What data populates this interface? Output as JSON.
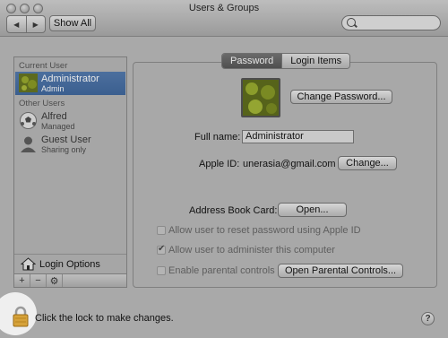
{
  "window": {
    "title": "Users & Groups"
  },
  "toolbar": {
    "back_icon": "back-arrow-icon",
    "forward_icon": "forward-arrow-icon",
    "show_all_label": "Show All",
    "search_placeholder": ""
  },
  "sidebar": {
    "current_user_header": "Current User",
    "other_users_header": "Other Users",
    "current_user": {
      "name": "Administrator",
      "role": "Admin"
    },
    "other_users": [
      {
        "name": "Alfred",
        "role": "Managed"
      },
      {
        "name": "Guest User",
        "role": "Sharing only"
      }
    ],
    "login_options_label": "Login Options",
    "add_label": "+",
    "remove_label": "−"
  },
  "main": {
    "tabs": [
      {
        "label": "Password",
        "active": true
      },
      {
        "label": "Login Items",
        "active": false
      }
    ],
    "change_password_label": "Change Password...",
    "full_name_label": "Full name:",
    "full_name_value": "Administrator",
    "apple_id_label": "Apple ID:",
    "apple_id_value": "unerasia@gmail.com",
    "change_label": "Change...",
    "address_book_label": "Address Book Card:",
    "open_label": "Open...",
    "checkboxes": [
      {
        "label": "Allow user to reset password using Apple ID",
        "checked": false
      },
      {
        "label": "Allow user to administer this computer",
        "checked": true
      },
      {
        "label": "Enable parental controls",
        "checked": false
      }
    ],
    "open_parental_label": "Open Parental Controls..."
  },
  "footer": {
    "lock_text": "Click the lock to make changes.",
    "help_label": "?"
  },
  "colors": {
    "selection": "#4c6f9e",
    "lock_gold": "#d6a23a",
    "background_dim": "#a9a9a9"
  }
}
